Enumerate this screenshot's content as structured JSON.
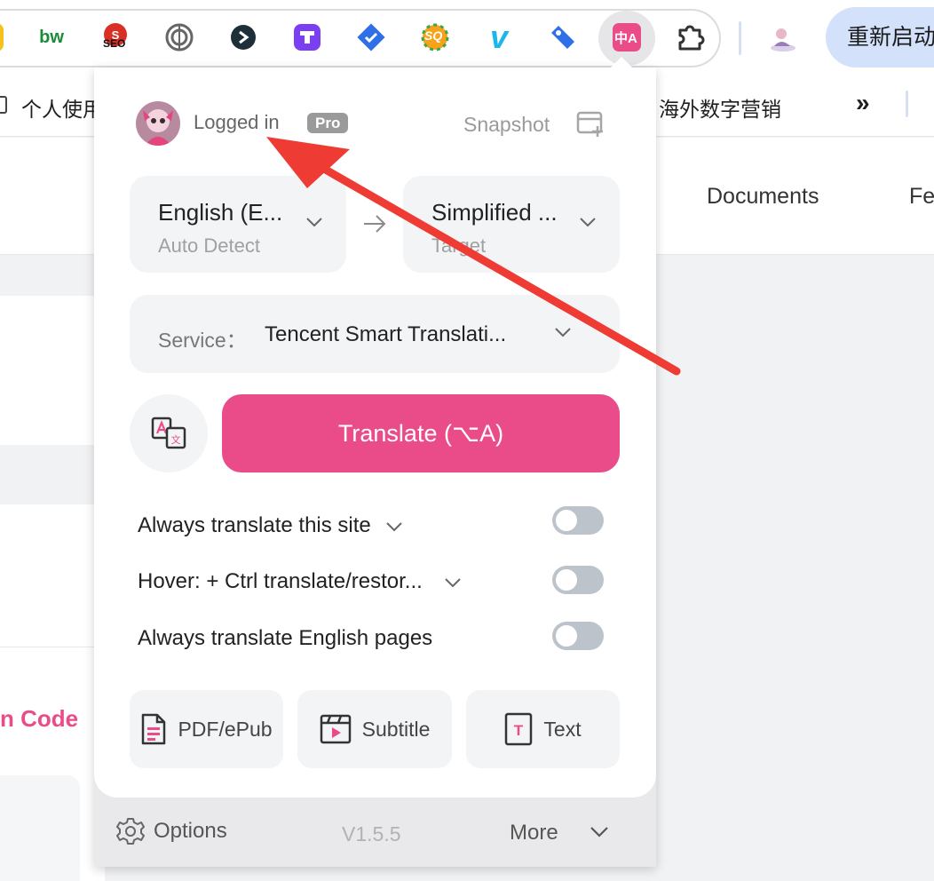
{
  "toolbar": {
    "extensions": [
      {
        "name": "bw",
        "label": "bw"
      },
      {
        "name": "seo",
        "label": "SEO"
      },
      {
        "name": "wordpress",
        "label": ""
      },
      {
        "name": "dark-arrow",
        "label": ""
      },
      {
        "name": "purple-t",
        "label": ""
      },
      {
        "name": "blue-check",
        "label": ""
      },
      {
        "name": "sq",
        "label": "SQ"
      },
      {
        "name": "vimeo",
        "label": "v"
      },
      {
        "name": "tag",
        "label": ""
      },
      {
        "name": "translate",
        "label": "中A"
      },
      {
        "name": "extensions-puzzle",
        "label": ""
      }
    ],
    "relaunch_label": "重新启动"
  },
  "bookmarks": {
    "left_item": "个人使用",
    "right_item": "海外数字营销",
    "overflow": "»"
  },
  "page": {
    "nav_documents": "Documents",
    "nav_partial": "Fe",
    "code_text": "n Code"
  },
  "popup": {
    "login_status": "Logged in",
    "plan_badge": "Pro",
    "snapshot_label": "Snapshot",
    "source_lang": "English (E...",
    "source_sub": "Auto Detect",
    "target_lang": "Simplified ...",
    "target_sub": "Target",
    "service_label": "Service：",
    "service_value": "Tencent Smart Translati...",
    "translate_label": "Translate (⌥A)",
    "options": [
      {
        "label": "Always translate this site",
        "has_dropdown": true,
        "enabled": false
      },
      {
        "label": "Hover:  + Ctrl translate/restor...",
        "has_dropdown": true,
        "enabled": false
      },
      {
        "label": "Always translate English pages",
        "has_dropdown": false,
        "enabled": false
      }
    ],
    "tools": [
      {
        "label": "PDF/ePub",
        "icon": "document-icon"
      },
      {
        "label": "Subtitle",
        "icon": "video-icon"
      },
      {
        "label": "Text",
        "icon": "text-file-icon"
      }
    ],
    "footer": {
      "options_label": "Options",
      "version": "V1.5.5",
      "more_label": "More"
    }
  },
  "colors": {
    "accent": "#ea4c89",
    "toggle_off": "#bcc3cb",
    "panel": "#f3f4f6",
    "annotation_arrow": "#ee3b34"
  }
}
